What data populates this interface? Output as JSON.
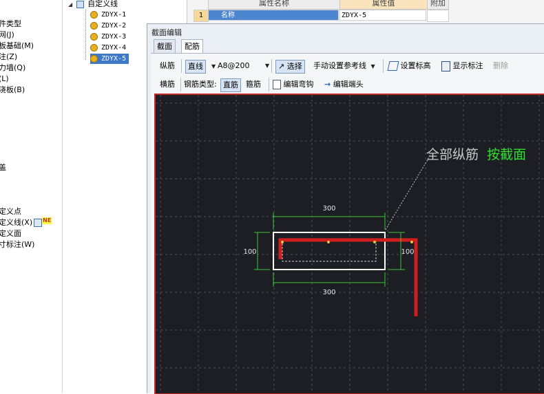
{
  "left_nav": {
    "items": [
      "件类型",
      "网(J)",
      "板基础(M)",
      "注(Z)",
      "力墙(Q)",
      "(L)",
      "浇板(B)",
      "盖",
      "定义点",
      "定义线(X)",
      "定义面",
      "寸标注(W)"
    ],
    "badge": "NE"
  },
  "tree": {
    "root_label": "自定义线",
    "items": [
      "ZDYX-1",
      "ZDYX-2",
      "ZDYX-3",
      "ZDYX-4",
      "ZDYX-5"
    ],
    "selected": "ZDYX-5"
  },
  "property_grid": {
    "col_name": "属性名称",
    "col_value": "属性值",
    "col_extra": "附加",
    "row_number": "1",
    "row_name": "名称",
    "row_value": "ZDYX-5"
  },
  "dialog": {
    "title": "截面编辑",
    "tabs": [
      "截面",
      "配筋"
    ],
    "active_tab": "配筋",
    "toolbar1": {
      "longitudinal_label": "纵筋",
      "mode_value": "直线",
      "rebar_value": "A8@200",
      "select_label": "选择",
      "ref_line_label": "手动设置参考线",
      "set_elevation_label": "设置标高",
      "show_annotation_label": "显示标注",
      "delete_label": "删除"
    },
    "toolbar2": {
      "transverse_label": "横筋",
      "rebar_type_label": "钢筋类型:",
      "straight_label": "直筋",
      "stirrup_label": "箍筋",
      "edit_bend_label": "编辑弯钩",
      "edit_end_label": "编辑端头"
    },
    "canvas": {
      "annotation_prefix": "全部纵筋",
      "annotation_highlight": "按截面",
      "dims": {
        "top": "300",
        "bottom": "300",
        "left": "100",
        "right": "100"
      },
      "colors": {
        "background": "#1d1e24",
        "grid": "#50525a",
        "section": "#ffffff",
        "rebar": "#d01e1e",
        "dimension": "#3cc83c",
        "highlight": "#2fe02f"
      }
    }
  }
}
